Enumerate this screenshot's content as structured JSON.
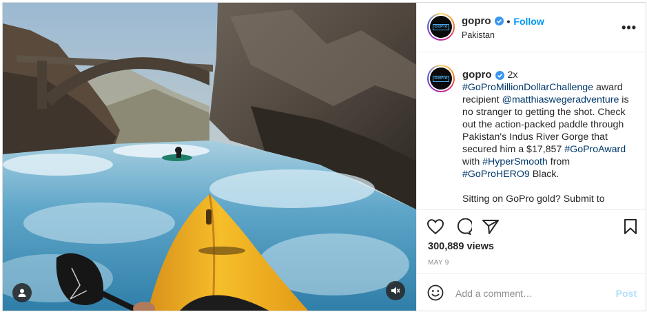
{
  "account": {
    "username": "gopro",
    "follow_label": "Follow",
    "location": "Pakistan",
    "dot": "•",
    "more_label": "•••"
  },
  "caption": {
    "username": "gopro",
    "speed": "2x",
    "segments": [
      {
        "text": "#GoProMillionDollarChallenge",
        "tag": true
      },
      {
        "text": " award recipient ",
        "tag": false
      },
      {
        "text": "@matthiaswegeradventure",
        "tag": true
      },
      {
        "text": " is no stranger to getting the shot. Check out the action-packed paddle through Pakistan's Indus River Gorge that secured him a $17,857 ",
        "tag": false
      },
      {
        "text": "#GoProAward",
        "tag": true
      },
      {
        "text": " with ",
        "tag": false
      },
      {
        "text": "#HyperSmooth",
        "tag": true
      },
      {
        "text": " from ",
        "tag": false
      },
      {
        "text": "#GoProHERO9",
        "tag": true
      },
      {
        "text": " Black.",
        "tag": false
      }
    ],
    "second_paragraph": "Sitting on GoPro gold? Submit to"
  },
  "stats": {
    "views": "300,889 views",
    "date": "MAY 9"
  },
  "comment": {
    "placeholder": "Add a comment…",
    "post_label": "Post"
  },
  "icons": {
    "like": "heart-icon",
    "comment": "comment-icon",
    "share": "paper-plane-icon",
    "save": "bookmark-icon",
    "emoji": "smiley-icon",
    "user_tag": "user-tag-icon",
    "mute": "muted-speaker-icon",
    "verified": "verified-badge-icon"
  },
  "colors": {
    "link": "#00376b",
    "follow": "#0095f6",
    "post_disabled": "#b2dffc",
    "muted_text": "#8e8e8e",
    "kayak": "#f2b21d"
  },
  "logo_text": "GoPro"
}
